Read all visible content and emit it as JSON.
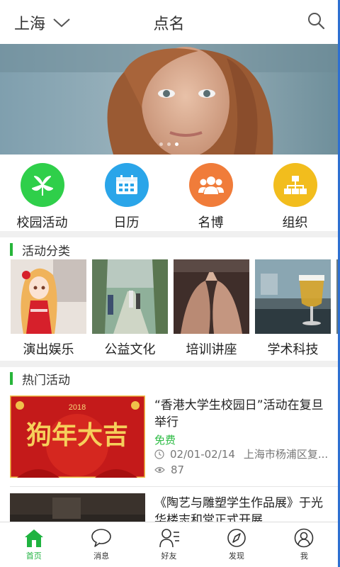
{
  "header": {
    "city": "上海",
    "title": "点名"
  },
  "banner": {
    "dots": 3,
    "active_dot": 3
  },
  "quick_nav": [
    {
      "label": "校园活动",
      "icon": "flower-icon",
      "color": "#2fcf4a"
    },
    {
      "label": "日历",
      "icon": "calendar-icon",
      "color": "#2aa5e9"
    },
    {
      "label": "名博",
      "icon": "people-icon",
      "color": "#f07c3a"
    },
    {
      "label": "组织",
      "icon": "org-chart-icon",
      "color": "#f2bd1d"
    }
  ],
  "category_section": {
    "title": "活动分类",
    "items": [
      {
        "label": "演出娱乐"
      },
      {
        "label": "公益文化"
      },
      {
        "label": "培训讲座"
      },
      {
        "label": "学术科技"
      }
    ]
  },
  "hot_section": {
    "title": "热门活动",
    "items": [
      {
        "title": "“香港大学生校园日”活动在复旦举行",
        "price": "免费",
        "date": "02/01-02/14",
        "location": "上海市杨浦区复...",
        "views": "87",
        "image_text": "狗年大吉",
        "image_year": "2018"
      },
      {
        "title": "《陶艺与雕塑学生作品展》于光华楼志和堂正式开展"
      }
    ]
  },
  "tabbar": [
    {
      "label": "首页",
      "icon": "home-icon",
      "active": true
    },
    {
      "label": "消息",
      "icon": "message-icon",
      "active": false
    },
    {
      "label": "好友",
      "icon": "friends-icon",
      "active": false
    },
    {
      "label": "发现",
      "icon": "compass-icon",
      "active": false
    },
    {
      "label": "我",
      "icon": "user-icon",
      "active": false
    }
  ],
  "colors": {
    "accent": "#27b53a",
    "free": "#2dbb44"
  }
}
